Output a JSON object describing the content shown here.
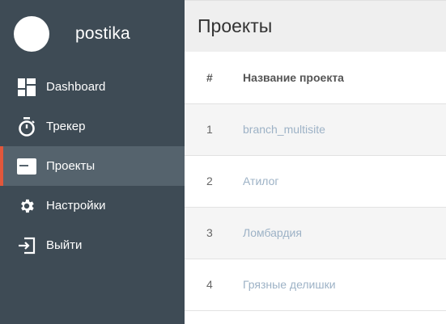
{
  "brand": {
    "name": "postika"
  },
  "nav": [
    {
      "label": "Dashboard",
      "icon": "dashboard-icon",
      "active": false
    },
    {
      "label": "Трекер",
      "icon": "stopwatch-icon",
      "active": false
    },
    {
      "label": "Проекты",
      "icon": "card-icon",
      "active": true
    },
    {
      "label": "Настройки",
      "icon": "gear-icon",
      "active": false
    },
    {
      "label": "Выйти",
      "icon": "logout-icon",
      "active": false
    }
  ],
  "page": {
    "title": "Проекты"
  },
  "table": {
    "headers": {
      "num": "#",
      "name": "Название проекта"
    },
    "rows": [
      {
        "num": "1",
        "name": "branch_multisite"
      },
      {
        "num": "2",
        "name": "Атилог"
      },
      {
        "num": "3",
        "name": "Ломбардия"
      },
      {
        "num": "4",
        "name": "Грязные делишки"
      }
    ]
  },
  "colors": {
    "sidebar": "#3e4b55",
    "sidebar_active": "#55636d",
    "active_accent": "#e2573b",
    "link": "#9db2c6"
  }
}
